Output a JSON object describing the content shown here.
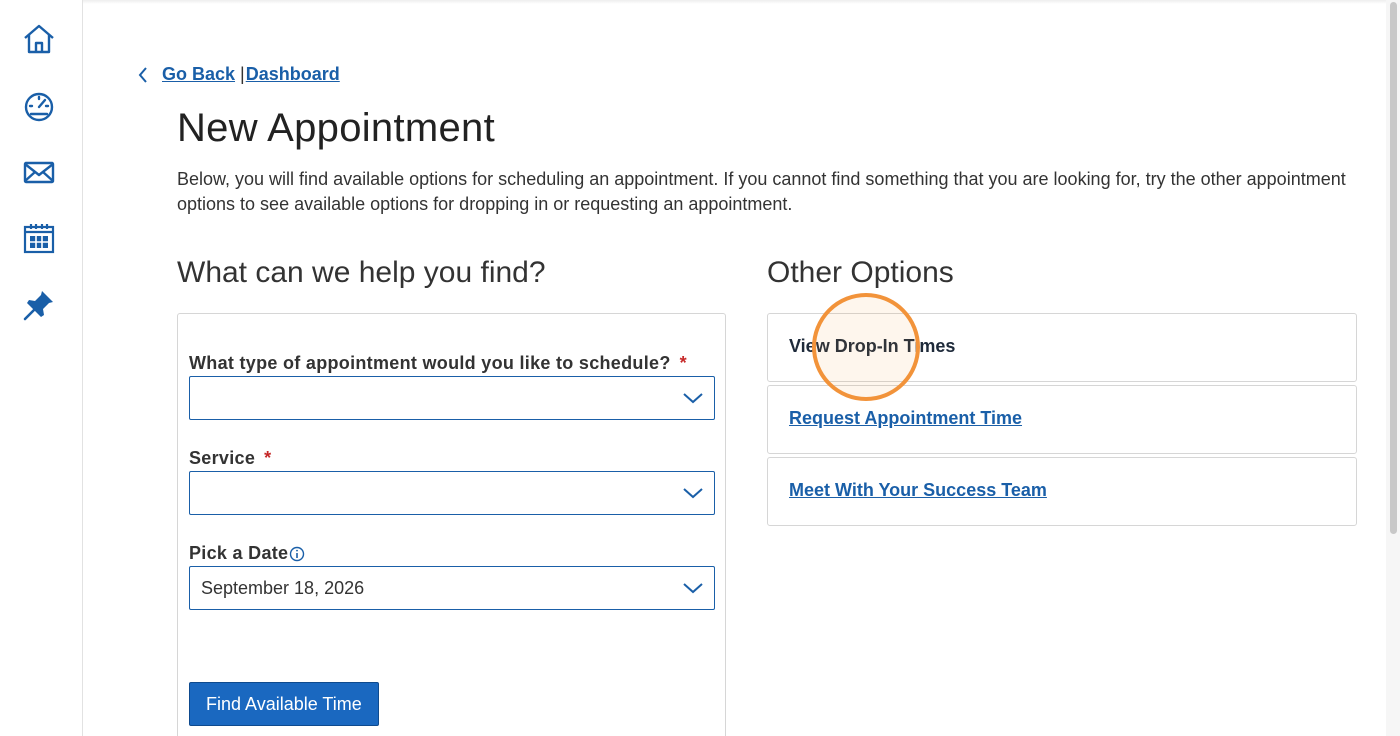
{
  "rail": {
    "items": [
      {
        "icon": "home-icon",
        "label": "Home"
      },
      {
        "icon": "dashboard-gauge-icon",
        "label": "Dashboard"
      },
      {
        "icon": "mail-icon",
        "label": "Messages"
      },
      {
        "icon": "calendar-icon",
        "label": "Calendar"
      },
      {
        "icon": "pin-icon",
        "label": "Pinned"
      }
    ],
    "accent": "#1a5fa8"
  },
  "breadcrumb": {
    "back": "Go Back",
    "separator": "|",
    "current": "Dashboard"
  },
  "page": {
    "title": "New Appointment",
    "intro": "Below, you will find available options for scheduling an appointment. If you cannot find something that you are looking for, try the other appointment options to see available options for dropping in or requesting an appointment."
  },
  "form": {
    "heading": "What can we help you find?",
    "fields": [
      {
        "label": "What type of appointment would you like to schedule?",
        "required": "*",
        "value": ""
      },
      {
        "label": "Service",
        "required": "*",
        "value": ""
      },
      {
        "label": "Pick a Date",
        "value": "September 18, 2026"
      }
    ],
    "submit_label": "Find Available Time"
  },
  "other_options": {
    "heading": "Other Options",
    "items": [
      {
        "label": "View Drop-In Times"
      },
      {
        "label": "Request Appointment Time"
      },
      {
        "label": "Meet With Your Success Team"
      }
    ]
  },
  "colors": {
    "link": "#1a5fa8",
    "primary_button": "#1a68c0",
    "required": "#c62828",
    "highlight": "#f2933a"
  }
}
